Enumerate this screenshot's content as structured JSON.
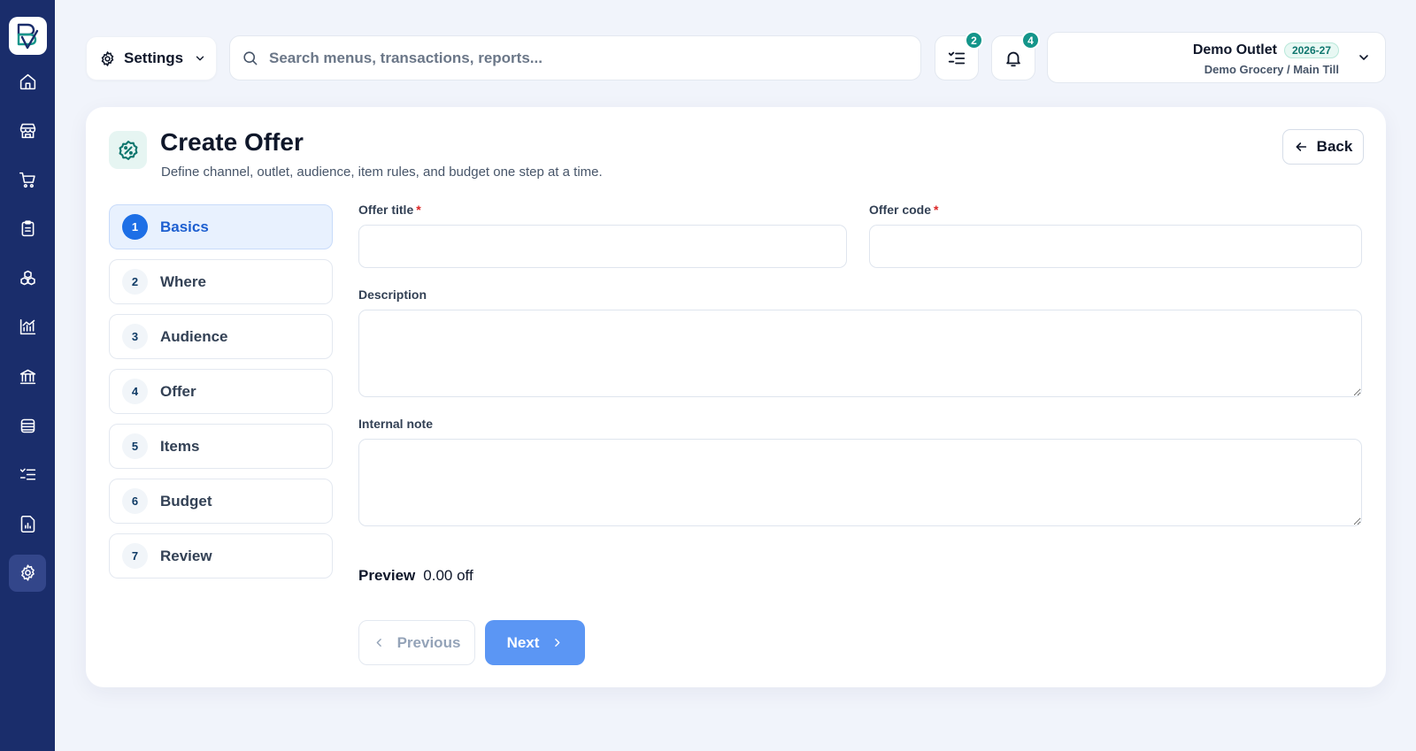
{
  "sidebar": {
    "logo_icon": "brand-logo-icon",
    "items": [
      {
        "icon": "home-icon"
      },
      {
        "icon": "store-icon"
      },
      {
        "icon": "cart-icon"
      },
      {
        "icon": "clipboard-icon"
      },
      {
        "icon": "boxes-icon"
      },
      {
        "icon": "chart-icon"
      },
      {
        "icon": "bank-icon"
      },
      {
        "icon": "database-icon"
      },
      {
        "icon": "checklist-icon"
      },
      {
        "icon": "report-icon"
      },
      {
        "icon": "gear-icon",
        "active": true
      }
    ],
    "colors": {
      "background": "#1a2d6b",
      "active": "#33468a"
    }
  },
  "topbar": {
    "settings_label": "Settings",
    "search_placeholder": "Search menus, transactions, reports...",
    "tasks_badge": "2",
    "notifications_badge": "4",
    "outlet_name": "Demo Outlet",
    "fiscal_year": "2026-27",
    "outlet_sub": "Demo Grocery / Main Till"
  },
  "page": {
    "title": "Create Offer",
    "subtitle": "Define channel, outlet, audience, item rules, and budget one step at a time.",
    "back_label": "Back"
  },
  "steps": [
    {
      "num": "1",
      "label": "Basics",
      "active": true
    },
    {
      "num": "2",
      "label": "Where"
    },
    {
      "num": "3",
      "label": "Audience"
    },
    {
      "num": "4",
      "label": "Offer"
    },
    {
      "num": "5",
      "label": "Items"
    },
    {
      "num": "6",
      "label": "Budget"
    },
    {
      "num": "7",
      "label": "Review"
    }
  ],
  "form": {
    "offer_title_label": "Offer title",
    "offer_title_value": "",
    "offer_code_label": "Offer code",
    "offer_code_value": "",
    "required_mark": "*",
    "description_label": "Description",
    "description_value": "",
    "internal_note_label": "Internal note",
    "internal_note_value": "",
    "preview_label": "Preview",
    "preview_value": "0.00 off",
    "previous_label": "Previous",
    "next_label": "Next"
  },
  "colors": {
    "accent": "#1d6fe6",
    "next_button": "#5b96f4",
    "badge": "#14958a",
    "required": "#dc2626"
  }
}
